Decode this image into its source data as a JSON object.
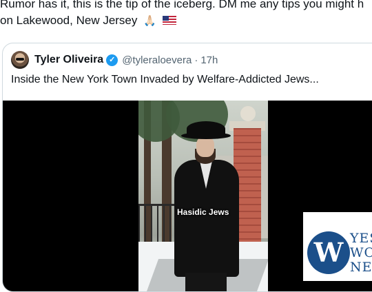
{
  "post": {
    "text_line1": "Rumor has it, this is the tip of the iceberg. DM me any tips you might h",
    "text_line2": "on Lakewood, New Jersey",
    "emoji_pray": "🙏🏻",
    "emoji_flag": "🇺🇸"
  },
  "quoted_post": {
    "author_name": "Tyler Oliveira",
    "verified_icon": "✓",
    "handle": "@tyleraloevera",
    "separator": "·",
    "time": "17h",
    "text": "Inside the New York Town Invaded by Welfare-Addicted Jews...",
    "video_caption": "Hasidic Jews"
  },
  "watermark": {
    "logo_letter": "W",
    "line1": "YES",
    "line2": "WO",
    "line3": "NE"
  },
  "colors": {
    "text_primary": "#0f1419",
    "text_secondary": "#536471",
    "verified_blue": "#1d9bf0",
    "border": "#cfd9de",
    "watermark_blue": "#1b4f8a"
  }
}
